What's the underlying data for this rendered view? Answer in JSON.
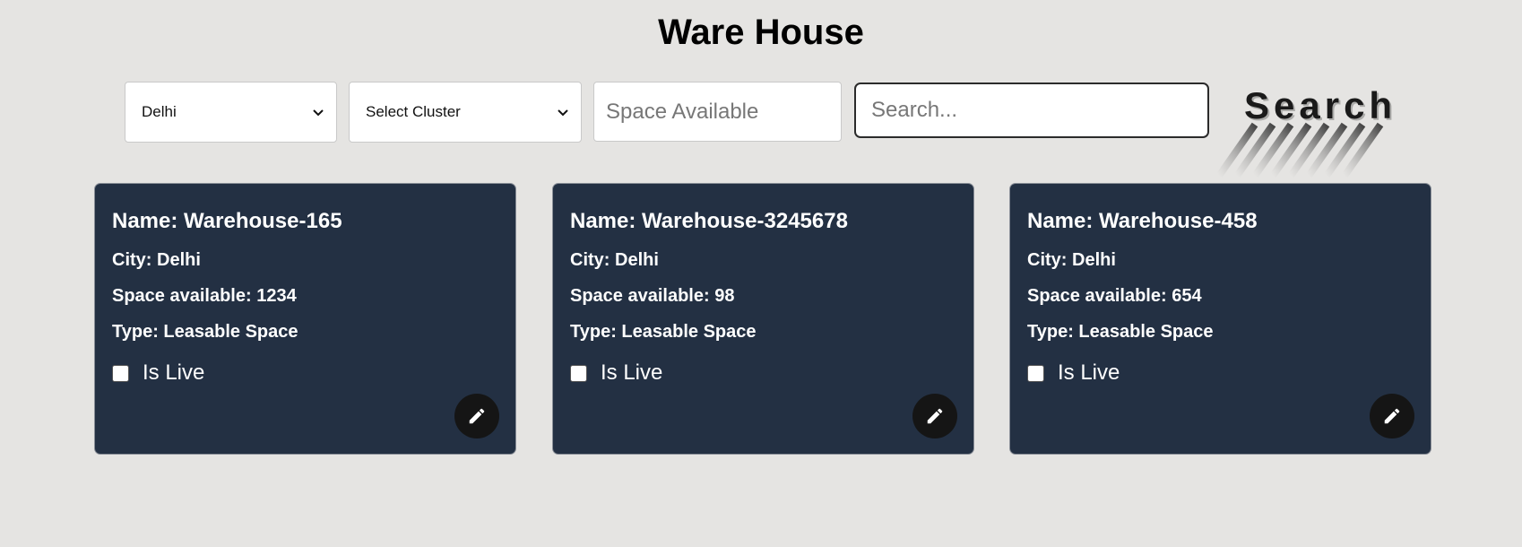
{
  "page": {
    "title": "Ware House"
  },
  "filters": {
    "city_select": {
      "value": "Delhi"
    },
    "cluster_select": {
      "value": "Select Cluster"
    },
    "space_input": {
      "placeholder": "Space Available"
    },
    "search_input": {
      "placeholder": "Search..."
    },
    "search_button": {
      "label": "Search"
    }
  },
  "cards": [
    {
      "name": "Name: Warehouse-165",
      "city": "City: Delhi",
      "space": "Space available: 1234",
      "type": "Type: Leasable Space",
      "live_label": "Is Live"
    },
    {
      "name": "Name: Warehouse-3245678",
      "city": "City: Delhi",
      "space": "Space available: 98",
      "type": "Type: Leasable Space",
      "live_label": "Is Live"
    },
    {
      "name": "Name: Warehouse-458",
      "city": "City: Delhi",
      "space": "Space available: 654",
      "type": "Type: Leasable Space",
      "live_label": "Is Live"
    }
  ],
  "icons": {
    "edit": "pencil-icon",
    "dropdown": "chevron-down-icon"
  },
  "colors": {
    "page_background": "#e5e4e2",
    "card_background": "#233043",
    "edit_button": "#151515"
  }
}
